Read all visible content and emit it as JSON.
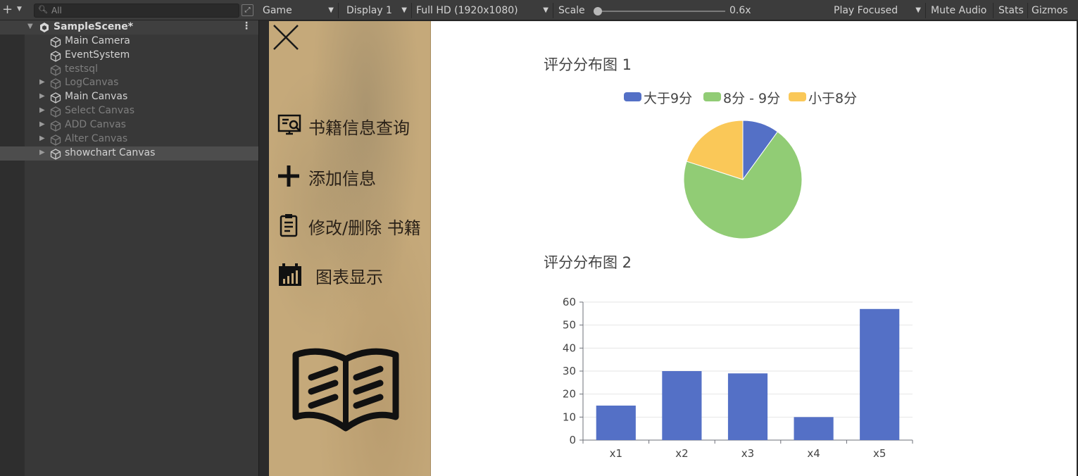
{
  "hierarchy": {
    "search_placeholder": "All",
    "scene": "SampleScene*",
    "items": [
      {
        "label": "Main Camera"
      },
      {
        "label": "EventSystem"
      },
      {
        "label": "testsql"
      },
      {
        "label": "LogCanvas"
      },
      {
        "label": "Main Canvas"
      },
      {
        "label": "Select Canvas"
      },
      {
        "label": "ADD Canvas"
      },
      {
        "label": "Alter Canvas"
      },
      {
        "label": "showchart Canvas"
      }
    ]
  },
  "game_toolbar": {
    "view": "Game",
    "display": "Display 1",
    "resolution": "Full HD (1920x1080)",
    "scale_label": "Scale",
    "scale_value": "0.6x",
    "scale": 0.6,
    "play_mode": "Play Focused",
    "mute": "Mute Audio",
    "stats": "Stats",
    "gizmos": "Gizmos"
  },
  "sidebar": {
    "menu": [
      {
        "label": "书籍信息查询",
        "icon": "search-monitor-icon"
      },
      {
        "label": "添加信息",
        "icon": "plus-icon"
      },
      {
        "label": "修改/删除 书籍",
        "icon": "clipboard-icon"
      },
      {
        "label": "图表显示",
        "icon": "chart-calendar-icon"
      }
    ]
  },
  "colors": {
    "blue": "#5470c6",
    "green": "#91cc75",
    "yellow": "#fac858"
  },
  "chart_data": [
    {
      "type": "pie",
      "title": "评分分布图 1",
      "categories": [
        "大于9分",
        "8分 - 9分",
        "小于8分"
      ],
      "values": [
        10,
        70,
        20
      ]
    },
    {
      "type": "bar",
      "title": "评分分布图 2",
      "categories": [
        "x1",
        "x2",
        "x3",
        "x4",
        "x5"
      ],
      "values": [
        15,
        30,
        29,
        10,
        57
      ],
      "ylim": [
        0,
        60
      ],
      "yticks": [
        0,
        10,
        20,
        30,
        40,
        50,
        60
      ],
      "grid": true
    }
  ]
}
